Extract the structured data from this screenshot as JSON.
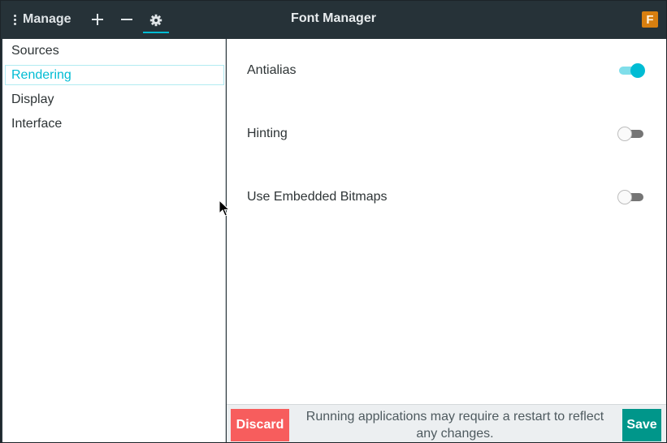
{
  "window": {
    "title": "Font Manager",
    "app_badge": "F"
  },
  "header": {
    "menu_label": "Manage",
    "buttons": [
      {
        "icon": "plus-icon"
      },
      {
        "icon": "minus-icon"
      },
      {
        "icon": "gear-icon",
        "active": true
      }
    ]
  },
  "sidebar": {
    "items": [
      {
        "label": "Sources",
        "selected": false
      },
      {
        "label": "Rendering",
        "selected": true
      },
      {
        "label": "Display",
        "selected": false
      },
      {
        "label": "Interface",
        "selected": false
      }
    ]
  },
  "settings": [
    {
      "label": "Antialias",
      "enabled": true
    },
    {
      "label": "Hinting",
      "enabled": false
    },
    {
      "label": "Use Embedded Bitmaps",
      "enabled": false
    }
  ],
  "footer": {
    "discard_label": "Discard",
    "message": "Running applications may require a restart to reflect any changes.",
    "save_label": "Save"
  },
  "colors": {
    "accent": "#00bcd4",
    "headerbar": "#263238",
    "discard": "#f75d5d",
    "save": "#00968a"
  }
}
